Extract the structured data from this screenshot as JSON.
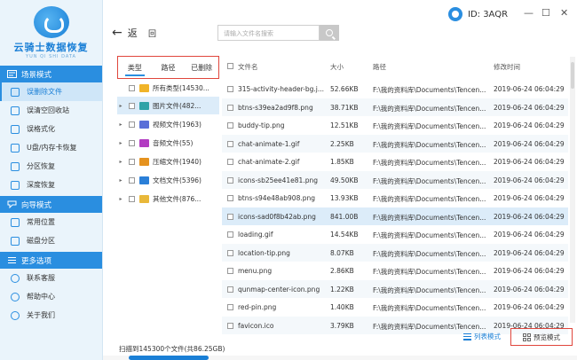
{
  "app": {
    "logo_title": "云骑士数据恢复",
    "logo_sub": "YUN QI SHI DATA"
  },
  "header": {
    "id_label": "ID: 3AQR",
    "min": "—",
    "restore": "☐",
    "close": "✕"
  },
  "toolbar": {
    "back_label": "返",
    "back_arrow": "←",
    "home_label": "回",
    "search_placeholder": "请输入文件名搜索"
  },
  "sidebar": {
    "sections": [
      {
        "title": "场景模式",
        "items": [
          "误删除文件",
          "误清空回收站",
          "误格式化",
          "U盘/内存卡恢复",
          "分区恢复",
          "深度恢复"
        ]
      },
      {
        "title": "向导模式",
        "items": [
          "常用位置",
          "磁盘分区"
        ]
      },
      {
        "title": "更多选项",
        "items": [
          "联系客服",
          "帮助中心",
          "关于我们"
        ]
      }
    ],
    "active_item": "误删除文件"
  },
  "tree": {
    "tabs": [
      "类型",
      "路径",
      "已删除"
    ],
    "active_tab": "类型",
    "nodes": [
      {
        "label": "所有类型(14530...",
        "expander": "",
        "color": "#f0b429"
      },
      {
        "label": "图片文件(482...",
        "expander": "▸",
        "color": "#2fa3a8"
      },
      {
        "label": "视频文件(1963)",
        "expander": "▸",
        "color": "#5a6fd8"
      },
      {
        "label": "音频文件(55)",
        "expander": "▸",
        "color": "#b23cc2"
      },
      {
        "label": "压缩文件(1940)",
        "expander": "▸",
        "color": "#e5921f"
      },
      {
        "label": "文档文件(5396)",
        "expander": "▸",
        "color": "#2a7fd8"
      },
      {
        "label": "其他文件(876...",
        "expander": "▸",
        "color": "#e9b83a"
      }
    ]
  },
  "table": {
    "columns": [
      "文件名",
      "大小",
      "路径",
      "修改时间"
    ],
    "rows": [
      {
        "name": "315-activity-header-bg.j...",
        "size": "52.66KB",
        "path": "F:\\我的资料库\\Documents\\Tencen...",
        "time": "2019-06-24 06:04:29"
      },
      {
        "name": "btns-s39ea2ad9f8.png",
        "size": "38.71KB",
        "path": "F:\\我的资料库\\Documents\\Tencen...",
        "time": "2019-06-24 06:04:29"
      },
      {
        "name": "buddy-tip.png",
        "size": "12.51KB",
        "path": "F:\\我的资料库\\Documents\\Tencen...",
        "time": "2019-06-24 06:04:29"
      },
      {
        "name": "chat-animate-1.gif",
        "size": "2.25KB",
        "path": "F:\\我的资料库\\Documents\\Tencen...",
        "time": "2019-06-24 06:04:29"
      },
      {
        "name": "chat-animate-2.gif",
        "size": "1.85KB",
        "path": "F:\\我的资料库\\Documents\\Tencen...",
        "time": "2019-06-24 06:04:29"
      },
      {
        "name": "icons-sb25ee41e81.png",
        "size": "49.50KB",
        "path": "F:\\我的资料库\\Documents\\Tencen...",
        "time": "2019-06-24 06:04:29"
      },
      {
        "name": "btns-s94e48ab908.png",
        "size": "13.93KB",
        "path": "F:\\我的资料库\\Documents\\Tencen...",
        "time": "2019-06-24 06:04:29"
      },
      {
        "name": "icons-sad0f8b42ab.png",
        "size": "841.00B",
        "path": "F:\\我的资料库\\Documents\\Tencen...",
        "time": "2019-06-24 06:04:29"
      },
      {
        "name": "loading.gif",
        "size": "14.54KB",
        "path": "F:\\我的资料库\\Documents\\Tencen...",
        "time": "2019-06-24 06:04:29"
      },
      {
        "name": "location-tip.png",
        "size": "8.07KB",
        "path": "F:\\我的资料库\\Documents\\Tencen...",
        "time": "2019-06-24 06:04:29"
      },
      {
        "name": "menu.png",
        "size": "2.86KB",
        "path": "F:\\我的资料库\\Documents\\Tencen...",
        "time": "2019-06-24 06:04:29"
      },
      {
        "name": "qunmap-center-icon.png",
        "size": "1.22KB",
        "path": "F:\\我的资料库\\Documents\\Tencen...",
        "time": "2019-06-24 06:04:29"
      },
      {
        "name": "red-pin.png",
        "size": "1.40KB",
        "path": "F:\\我的资料库\\Documents\\Tencen...",
        "time": "2019-06-24 06:04:29"
      },
      {
        "name": "favicon.ico",
        "size": "3.79KB",
        "path": "F:\\我的资料库\\Documents\\Tencen...",
        "time": "2019-06-24 06:04:29"
      }
    ]
  },
  "footer": {
    "scan_status": "扫描到145300个文件(共86.25GB)",
    "list_mode": "列表模式",
    "preview_mode": "预览模式"
  },
  "colors": {
    "accent": "#2a8ee0",
    "highlight_box": "#e0463c",
    "sidebar_bg": "#eaf4fb"
  }
}
